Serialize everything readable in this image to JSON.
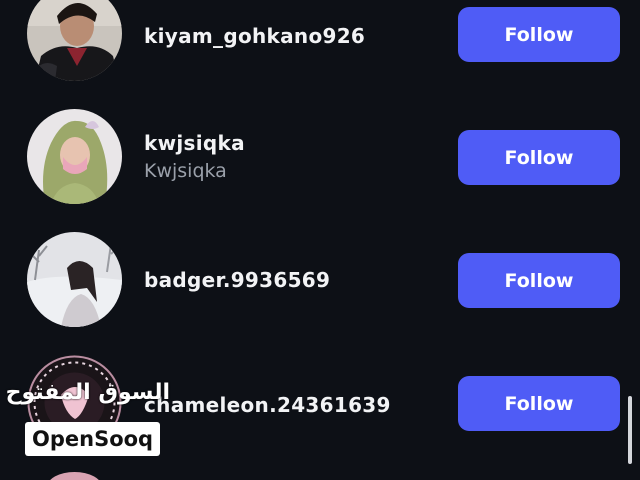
{
  "colors": {
    "background": "#0d1016",
    "follow_button": "#4f5cf6",
    "username": "#f2f3f5",
    "secondary_text": "#9aa0aa"
  },
  "users": [
    {
      "username": "kiyam_gohkano926",
      "fullname": "",
      "button": "Follow"
    },
    {
      "username": "kwjsiqka",
      "fullname": "Kwjsiqka",
      "button": "Follow"
    },
    {
      "username": "badger.9936569",
      "fullname": "",
      "button": "Follow"
    },
    {
      "username": "chameleon.24361639",
      "fullname": "",
      "button": "Follow"
    }
  ],
  "watermark": {
    "arabic": "السوق المفتوح",
    "brand": "OpenSooq"
  }
}
